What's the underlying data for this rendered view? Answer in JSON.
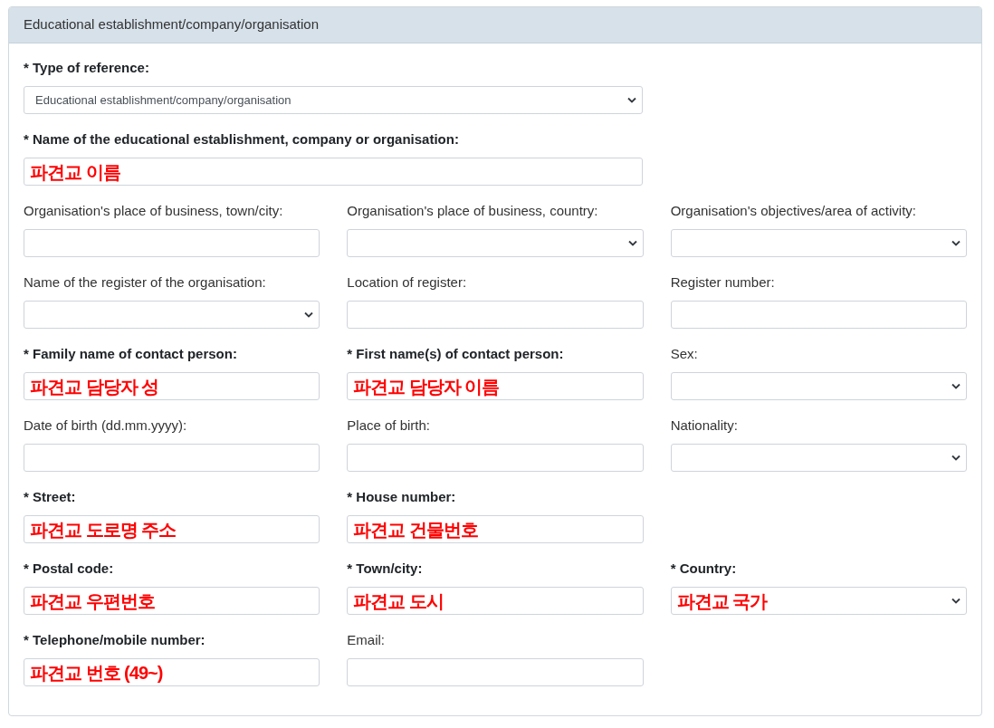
{
  "panel": {
    "title": "Educational establishment/company/organisation"
  },
  "wide_fields": [
    {
      "label": "* Type of reference:",
      "required": true,
      "kind": "select",
      "value": "Educational establishment/company/organisation",
      "annotated": false
    },
    {
      "label": "* Name of the educational establishment, company or organisation:",
      "required": true,
      "kind": "input",
      "value": "파견교 이름",
      "annotated": true
    }
  ],
  "rows": [
    [
      {
        "label": "Organisation's place of business, town/city:",
        "required": false,
        "kind": "input"
      },
      {
        "label": "Organisation's place of business, country:",
        "required": false,
        "kind": "select"
      },
      {
        "label": "Organisation's objectives/area of activity:",
        "required": false,
        "kind": "select"
      }
    ],
    [
      {
        "label": "Name of the register of the organisation:",
        "required": false,
        "kind": "select"
      },
      {
        "label": "Location of register:",
        "required": false,
        "kind": "input"
      },
      {
        "label": "Register number:",
        "required": false,
        "kind": "input"
      }
    ],
    [
      {
        "label": "* Family name of contact person:",
        "required": true,
        "kind": "input",
        "value": "파견교 담당자 성",
        "annotated": true
      },
      {
        "label": "* First name(s) of contact person:",
        "required": true,
        "kind": "input",
        "value": "파견교 담당자 이름",
        "annotated": true
      },
      {
        "label": "Sex:",
        "required": false,
        "kind": "select"
      }
    ],
    [
      {
        "label": "Date of birth (dd.mm.yyyy):",
        "required": false,
        "kind": "input"
      },
      {
        "label": "Place of birth:",
        "required": false,
        "kind": "input"
      },
      {
        "label": "Nationality:",
        "required": false,
        "kind": "select"
      }
    ],
    [
      {
        "label": "* Street:",
        "required": true,
        "kind": "input",
        "value": "파견교 도로명 주소",
        "annotated": true
      },
      {
        "label": "* House number:",
        "required": true,
        "kind": "input",
        "value": "파견교 건물번호",
        "annotated": true
      }
    ],
    [
      {
        "label": "* Postal code:",
        "required": true,
        "kind": "input",
        "value": "파견교 우편번호",
        "annotated": true
      },
      {
        "label": "* Town/city:",
        "required": true,
        "kind": "input",
        "value": "파견교 도시",
        "annotated": true
      },
      {
        "label": "* Country:",
        "required": true,
        "kind": "select",
        "value": "파견교 국가",
        "annotated": true
      }
    ],
    [
      {
        "label": "* Telephone/mobile number:",
        "required": true,
        "kind": "input",
        "value": "파견교 번호 (49~)",
        "annotated": true
      },
      {
        "label": "Email:",
        "required": false,
        "kind": "input"
      }
    ]
  ]
}
